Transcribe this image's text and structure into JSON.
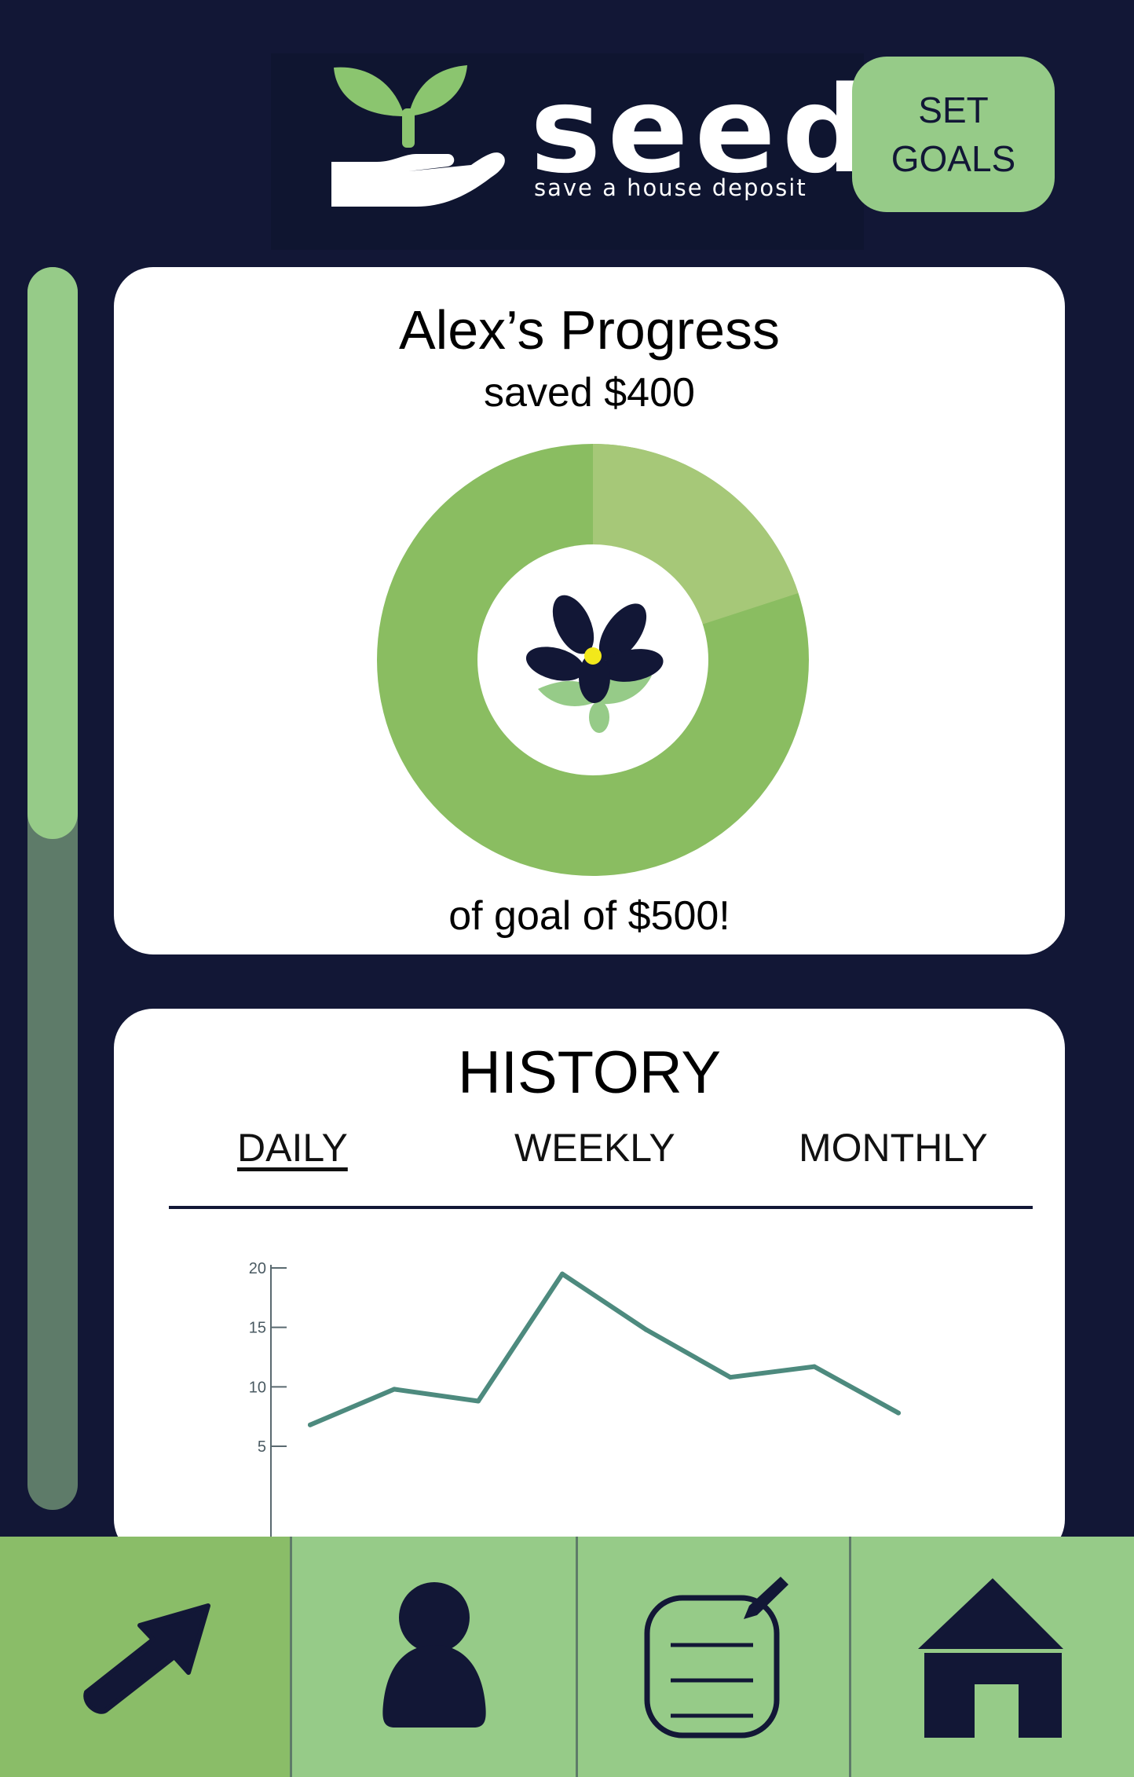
{
  "header": {
    "brand_name": "seed",
    "tagline": "save a house deposit",
    "set_goals_label": "SET GOALS"
  },
  "progress": {
    "title": "Alex’s Progress",
    "saved_text": "saved $400",
    "goal_text": "of goal of $500!",
    "saved_amount": 400,
    "goal_amount": 500,
    "fraction": 0.75
  },
  "history": {
    "title": "HISTORY",
    "tabs": [
      {
        "label": "DAILY",
        "active": true
      },
      {
        "label": "WEEKLY",
        "active": false
      },
      {
        "label": "MONTHLY",
        "active": false
      }
    ]
  },
  "chart_data": {
    "type": "line",
    "title": "",
    "xlabel": "",
    "ylabel": "",
    "x": [
      1,
      2,
      3,
      4,
      5,
      6,
      7,
      8
    ],
    "y": [
      6.8,
      9.8,
      8.8,
      19.5,
      14.8,
      10.8,
      11.7,
      7.8
    ],
    "yticks": [
      5,
      10,
      15,
      20
    ],
    "ytick_labels": [
      "5",
      "10",
      "15",
      "20"
    ],
    "ylim": [
      5,
      20
    ],
    "grid": false,
    "line_color": "#4d8a7e"
  },
  "scrollbar": {
    "position_fraction": 0.46
  },
  "bottom_nav": {
    "items": [
      {
        "icon": "arrow-up-right-icon",
        "active": true
      },
      {
        "icon": "user-icon",
        "active": false
      },
      {
        "icon": "notes-icon",
        "active": false
      },
      {
        "icon": "home-icon",
        "active": false
      }
    ]
  },
  "colors": {
    "background": "#121736",
    "accent_green": "#96cb88",
    "donut_dark": "#8abd61",
    "donut_light": "#a6c878",
    "scroll_track": "#5e7b69",
    "navy": "#121736"
  }
}
